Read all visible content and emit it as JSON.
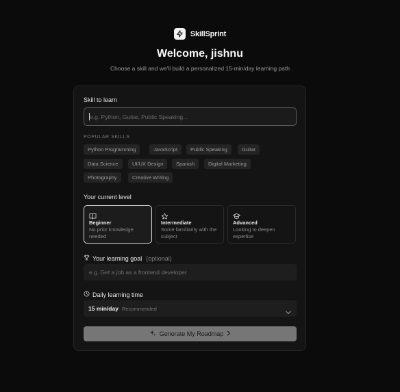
{
  "brand": {
    "name": "SkillSprint",
    "logo_icon": "lightning-bolt-icon"
  },
  "header": {
    "title": "Welcome, jishnu",
    "subtitle": "Choose a skill and we'll build a personalized 15-min/day learning path"
  },
  "skill": {
    "label": "Skill to learn",
    "placeholder": "e.g. Python, Guitar, Public Speaking...",
    "value": ""
  },
  "popular": {
    "title": "POPULAR SKILLS",
    "chips": [
      "Python Programming",
      "JavaScript",
      "Public Speaking",
      "Guitar",
      "Data Science",
      "UI/UX Design",
      "Spanish",
      "Digital Marketing",
      "Photography",
      "Creative Writing"
    ]
  },
  "level": {
    "label": "Your current level",
    "options": [
      {
        "title": "Beginner",
        "desc": "No prior knowledge needed",
        "icon": "book-icon",
        "selected": true
      },
      {
        "title": "Intermediate",
        "desc": "Some familiarity with the subject",
        "icon": "star-icon",
        "selected": false
      },
      {
        "title": "Advanced",
        "desc": "Looking to deepen expertise",
        "icon": "graduation-cap-icon",
        "selected": false
      }
    ]
  },
  "goal": {
    "label": "Your learning goal",
    "optional": "(optional)",
    "placeholder": "e.g. Get a job as a frontend developer",
    "icon": "trophy-icon"
  },
  "time": {
    "label": "Daily learning time",
    "icon": "clock-icon",
    "value": "15 min/day",
    "note": "Recommended"
  },
  "submit": {
    "label": "Generate My Roadmap",
    "icon": "sparkles-icon"
  },
  "colors": {
    "background": "#0b0b0b",
    "card": "#141414",
    "button": "#767676",
    "accent": "#f2f2f2"
  }
}
